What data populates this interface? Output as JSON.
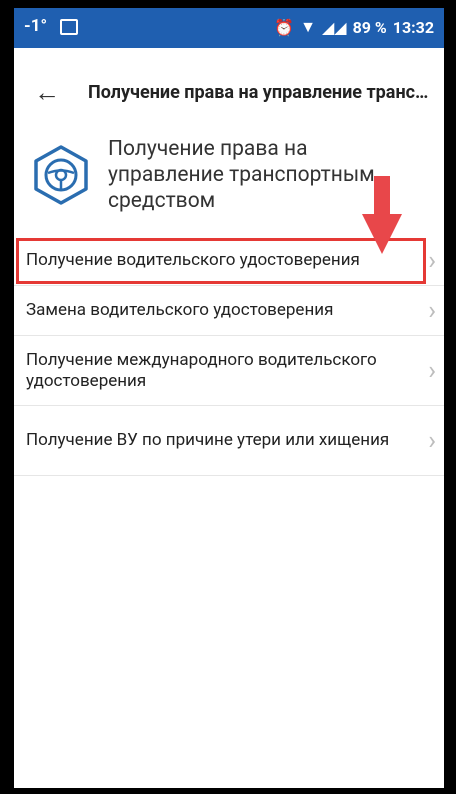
{
  "statusbar": {
    "temp": "-1°",
    "battery": "89 %",
    "time": "13:32"
  },
  "appbar": {
    "title": "Получение права на управление транспортным средством"
  },
  "header": {
    "text": "Получение права на управление транспортным средством",
    "icon": "steering-wheel-icon"
  },
  "list": {
    "items": [
      {
        "label": "Получение водительского удостоверения"
      },
      {
        "label": "Замена водительского удостоверения"
      },
      {
        "label": "Получение международного водительского удостоверения"
      },
      {
        "label": "Получение ВУ по причине утери или хищения"
      }
    ]
  },
  "colors": {
    "statusbar": "#1f5fb0",
    "highlight": "#e53935",
    "icon": "#2a6db0"
  }
}
